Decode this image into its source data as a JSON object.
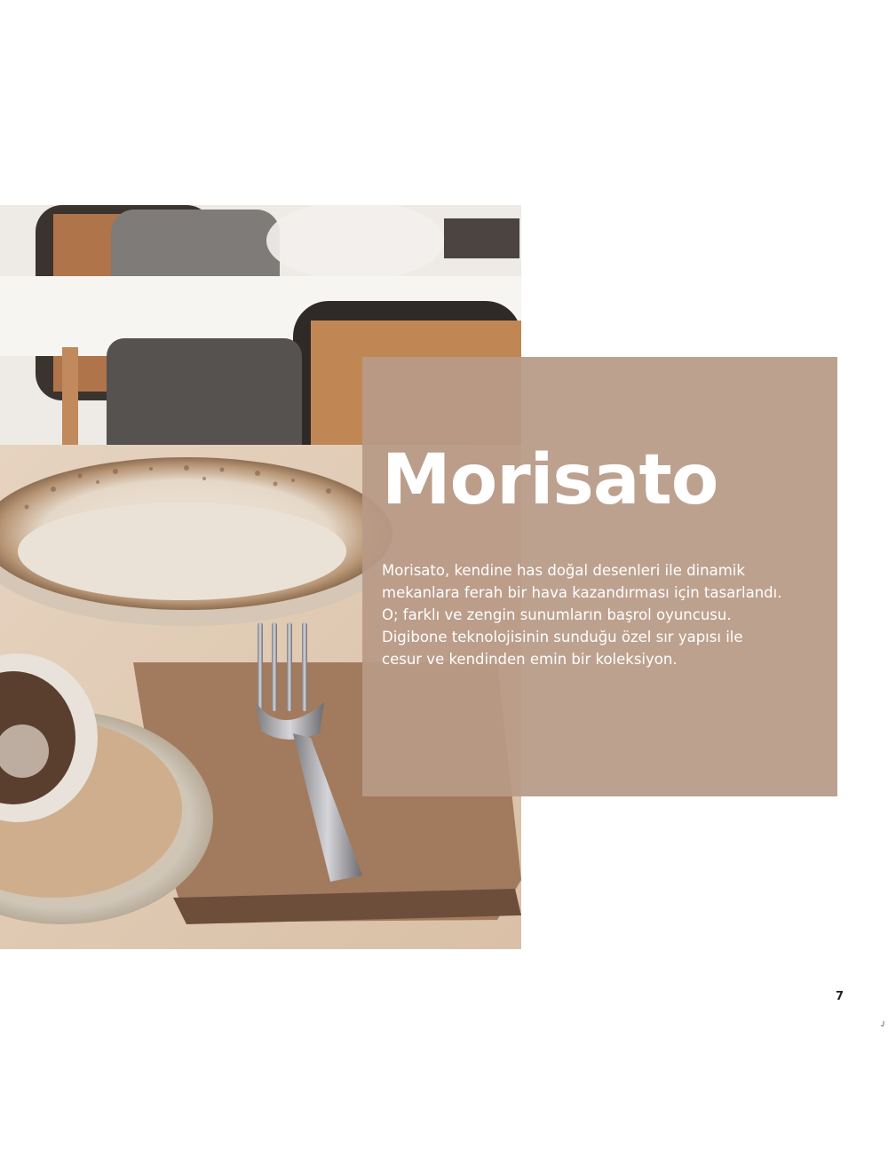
{
  "product": {
    "title": "Morisato",
    "description": "Morisato, kendine has doğal desenleri ile dinamik\nmekanlara ferah bir hava kazandırması için tasarlandı.\nO; farklı ve zengin sunumların başrol oyuncusu.\nDigibone teknolojisinin sunduğu özel sır yapısı ile\ncesur ve kendinden emin bir koleksiyon."
  },
  "page": {
    "number": "7"
  },
  "colors": {
    "panel": "#b89a87",
    "text": "#ffffff",
    "page_background": "#ffffff"
  },
  "photo": {
    "subject": "table-setting-photo"
  }
}
